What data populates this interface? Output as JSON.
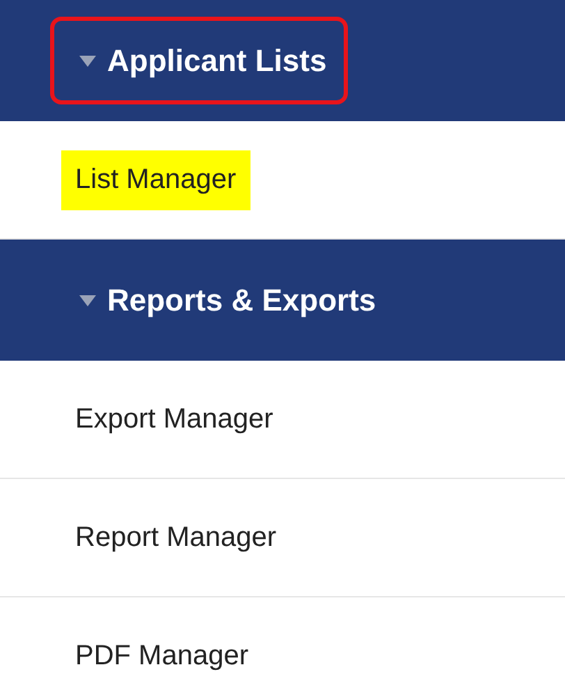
{
  "sections": [
    {
      "title": "Applicant Lists",
      "expanded": true,
      "outlined": true,
      "items": [
        {
          "label": "List Manager",
          "highlighted": true
        }
      ]
    },
    {
      "title": "Reports & Exports",
      "expanded": true,
      "outlined": false,
      "items": [
        {
          "label": "Export Manager",
          "highlighted": false
        },
        {
          "label": "Report Manager",
          "highlighted": false
        },
        {
          "label": "PDF Manager",
          "highlighted": false
        }
      ]
    }
  ]
}
